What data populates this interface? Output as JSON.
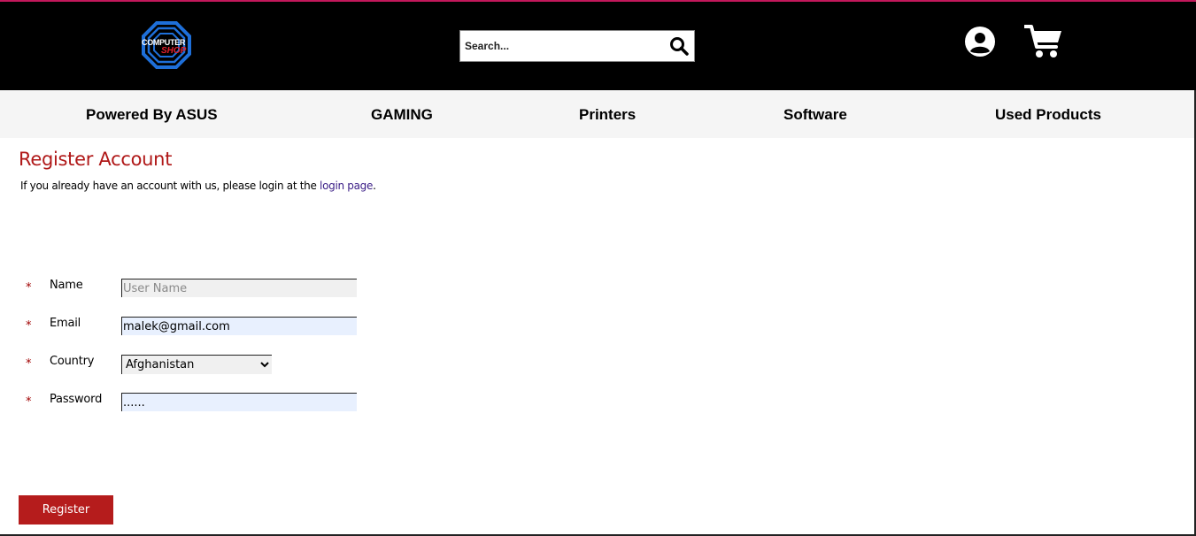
{
  "header": {
    "logo_line1": "COMPUTER",
    "logo_line2": "SHOP",
    "search_placeholder": "Search..."
  },
  "nav": {
    "items": [
      {
        "label": "Powered By ASUS"
      },
      {
        "label": "GAMING"
      },
      {
        "label": "Printers"
      },
      {
        "label": "Software"
      },
      {
        "label": "Used Products"
      }
    ]
  },
  "page": {
    "title": "Register Account",
    "info_prefix": "If you already have an account with us, please login at the ",
    "login_link": "login page",
    "info_suffix": "."
  },
  "form": {
    "required_mark": "*",
    "name": {
      "label": "Name",
      "placeholder": "User Name",
      "value": ""
    },
    "email": {
      "label": "Email",
      "value": "malek@gmail.com"
    },
    "country": {
      "label": "Country",
      "selected": "Afghanistan"
    },
    "password": {
      "label": "Password",
      "value": "......"
    },
    "submit_label": "Register"
  },
  "colors": {
    "header_bg": "#000000",
    "accent_red": "#b51c1c",
    "title_red": "#b01818",
    "link": "#3a1d86",
    "nav_bg": "#f5f5f5",
    "autofill_bg": "#e8f0fe"
  },
  "icons": {
    "logo": "octagon-logo-icon",
    "search": "search-icon",
    "user": "user-circle-icon",
    "cart": "shopping-cart-icon"
  }
}
